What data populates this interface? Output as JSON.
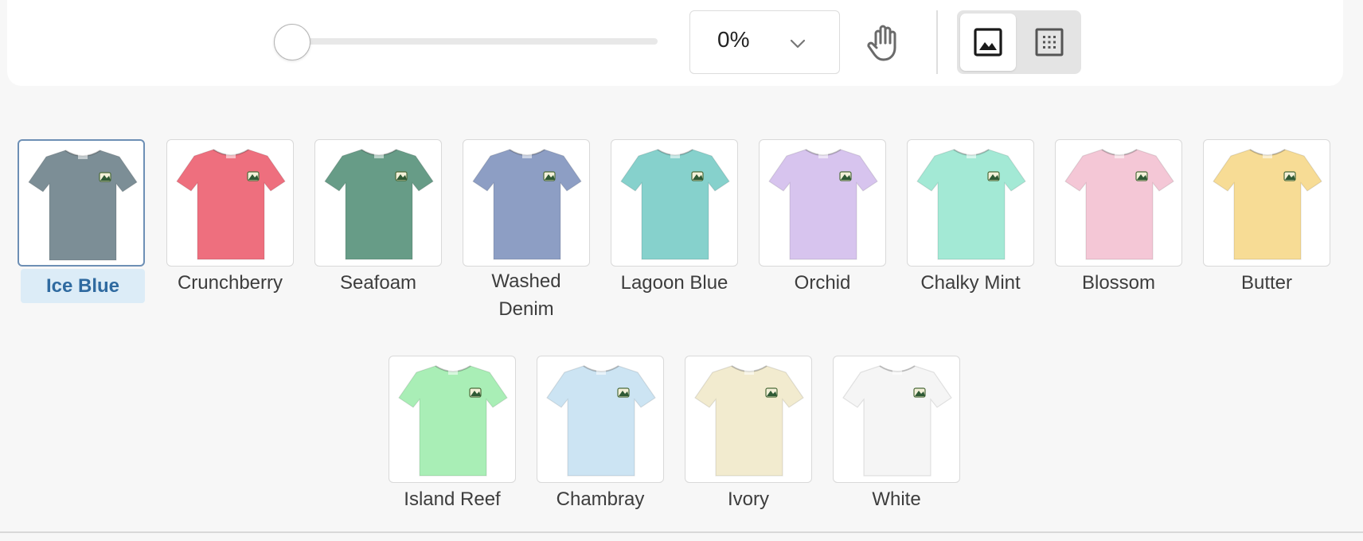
{
  "toolbar": {
    "zoom_value": "0%",
    "icons": {
      "chevron": "chevron-down-icon",
      "pan": "hand-pan-icon",
      "image_view": "image-icon",
      "grid_view": "grid-dots-icon"
    }
  },
  "swatches": [
    {
      "label": "Ice Blue",
      "color": "#7c8e96",
      "selected": true
    },
    {
      "label": "Crunchberry",
      "color": "#ee6f7e",
      "selected": false
    },
    {
      "label": "Seafoam",
      "color": "#679c87",
      "selected": false
    },
    {
      "label": "Washed Denim",
      "color": "#8d9ec4",
      "selected": false
    },
    {
      "label": "Lagoon Blue",
      "color": "#86d1cc",
      "selected": false
    },
    {
      "label": "Orchid",
      "color": "#d7c4ee",
      "selected": false
    },
    {
      "label": "Chalky Mint",
      "color": "#a3e9d5",
      "selected": false
    },
    {
      "label": "Blossom",
      "color": "#f4c7d6",
      "selected": false
    },
    {
      "label": "Butter",
      "color": "#f7dc95",
      "selected": false
    },
    {
      "label": "Island Reef",
      "color": "#a9eeb6",
      "selected": false
    },
    {
      "label": "Chambray",
      "color": "#cce4f3",
      "selected": false
    },
    {
      "label": "Ivory",
      "color": "#f2ebcf",
      "selected": false
    },
    {
      "label": "White",
      "color": "#f5f5f5",
      "selected": false
    }
  ]
}
